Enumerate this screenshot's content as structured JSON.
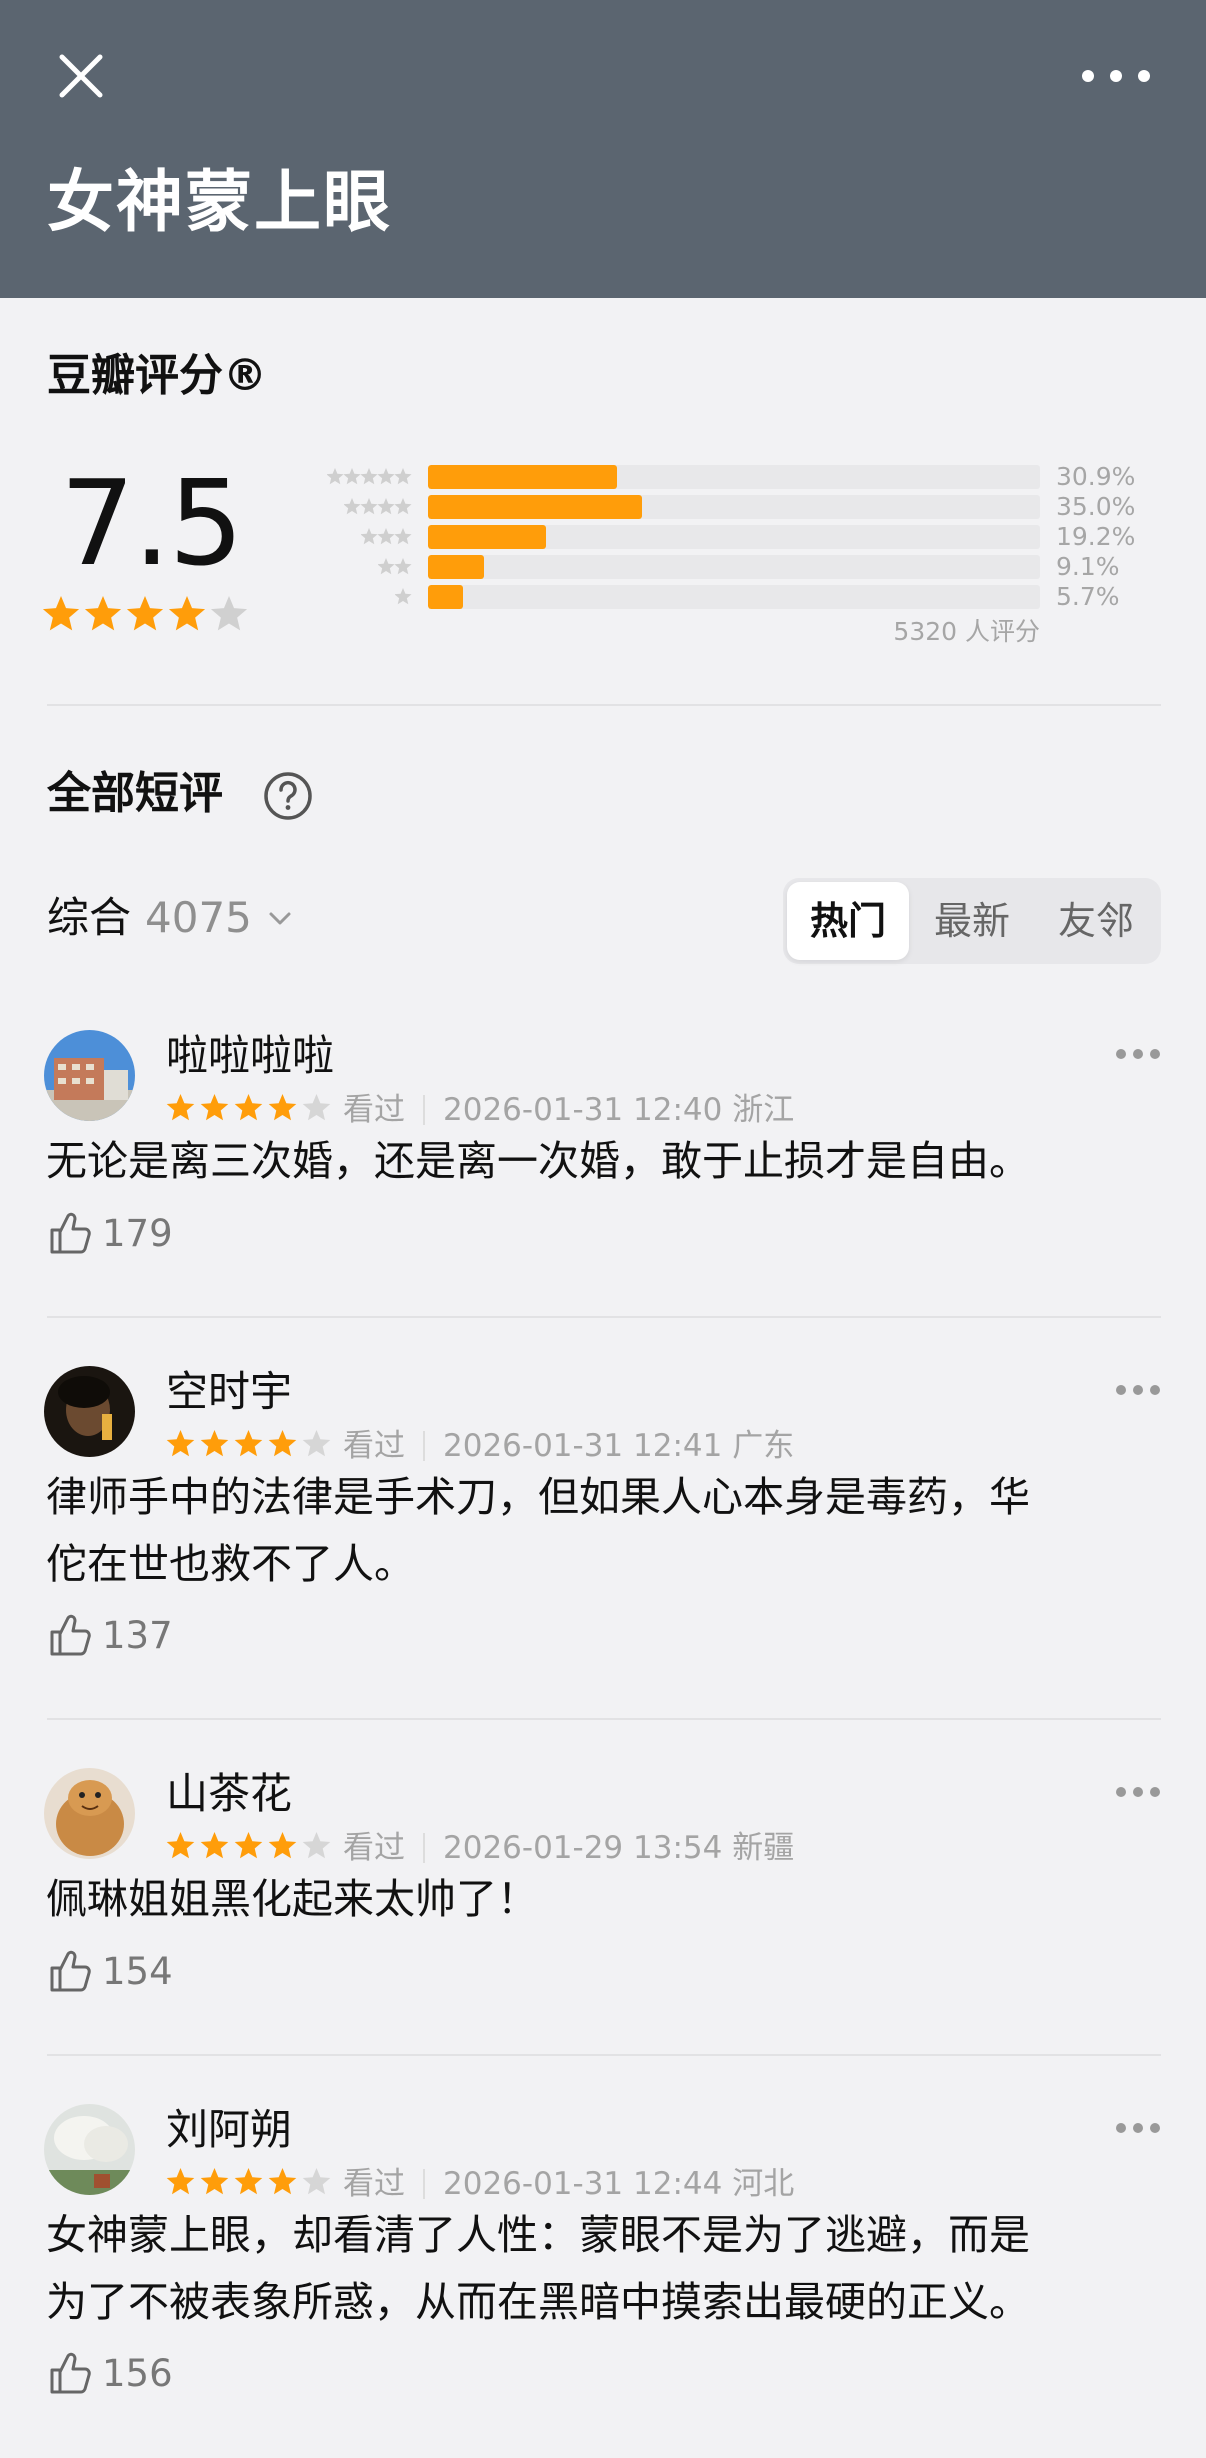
{
  "header": {
    "title": "女神蒙上眼",
    "close_icon": "close-icon",
    "more_icon": "more-dots-icon"
  },
  "rating": {
    "title": "豆瓣评分®",
    "score": "7.5",
    "score_stars": 4,
    "distribution": [
      {
        "stars": 5,
        "percent": "30.9%",
        "fraction": 0.309
      },
      {
        "stars": 4,
        "percent": "35.0%",
        "fraction": 0.35
      },
      {
        "stars": 3,
        "percent": "19.2%",
        "fraction": 0.192
      },
      {
        "stars": 2,
        "percent": "9.1%",
        "fraction": 0.091
      },
      {
        "stars": 1,
        "percent": "5.7%",
        "fraction": 0.057
      }
    ],
    "vote_count": "5320 人评分"
  },
  "comments_section": {
    "title": "全部短评",
    "help_icon": "question-circle-icon",
    "sort_label": "综合",
    "sort_count": "4075",
    "tabs": [
      {
        "label": "热门",
        "active": true
      },
      {
        "label": "最新",
        "active": false
      },
      {
        "label": "友邻",
        "active": false
      }
    ]
  },
  "comments": [
    {
      "user": "啦啦啦啦",
      "stars": 4,
      "status": "看过",
      "datetime": "2026-01-31 12:40 浙江",
      "text_lines": [
        "无论是离三次婚，还是离一次婚，敢于止损才是自由。"
      ],
      "likes": "179"
    },
    {
      "user": "空时宇",
      "stars": 4,
      "status": "看过",
      "datetime": "2026-01-31 12:41 广东",
      "text_lines": [
        "律师手中的法律是手术刀，但如果人心本身是毒药，华",
        "佗在世也救不了人。"
      ],
      "likes": "137"
    },
    {
      "user": "山茶花",
      "stars": 4,
      "status": "看过",
      "datetime": "2026-01-29 13:54 新疆",
      "text_lines": [
        "佩琳姐姐黑化起来太帅了！"
      ],
      "likes": "154"
    },
    {
      "user": "刘阿朔",
      "stars": 4,
      "status": "看过",
      "datetime": "2026-01-31 12:44 河北",
      "text_lines": [
        "女神蒙上眼，却看清了人性：蒙眼不是为了逃避，而是",
        "为了不被表象所惑，从而在黑暗中摸索出最硬的正义。"
      ],
      "likes": "156"
    }
  ],
  "colors": {
    "header_bg": "#5b6570",
    "star": "#ff9d0a",
    "bar": "#ff9d0a"
  }
}
